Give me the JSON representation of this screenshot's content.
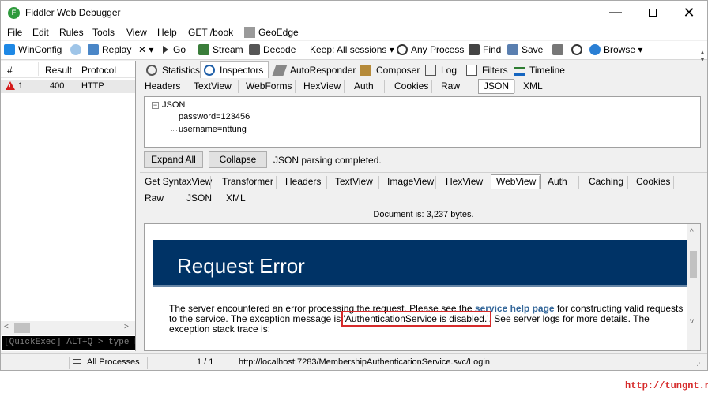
{
  "window": {
    "title": "Fiddler Web Debugger",
    "min_glyph": "—",
    "close_glyph": "✕"
  },
  "menu": [
    "File",
    "Edit",
    "Rules",
    "Tools",
    "View",
    "Help",
    "GET /book",
    "GeoEdge"
  ],
  "toolbar": {
    "winconfig": "WinConfig",
    "replay": "Replay",
    "remove": "✕ ▾",
    "go": "Go",
    "stream": "Stream",
    "decode": "Decode",
    "keep": "Keep: All sessions ▾",
    "any_process": "Any Process",
    "find": "Find",
    "save": "Save",
    "browse": "Browse ▾"
  },
  "sessions": {
    "columns": [
      "#",
      "Result",
      "Protocol"
    ],
    "rows": [
      {
        "id": "1",
        "result": "400",
        "protocol": "HTTP"
      }
    ],
    "quickexec": "[QuickExec] ALT+Q > type HELP t"
  },
  "inspector_tabs": [
    "Statistics",
    "Inspectors",
    "AutoResponder",
    "Composer",
    "Log",
    "Filters",
    "Timeline"
  ],
  "request_tabs": [
    "Headers",
    "TextView",
    "WebForms",
    "HexView",
    "Auth",
    "Cookies",
    "Raw",
    "JSON",
    "XML"
  ],
  "json_view": {
    "toggle": "−",
    "root": "JSON",
    "items": [
      "password=123456",
      "username=nttung"
    ],
    "expand_all": "Expand All",
    "collapse": "Collapse",
    "status": "JSON parsing completed."
  },
  "response_tabs_row1": [
    "Get SyntaxView",
    "Transformer",
    "Headers",
    "TextView",
    "ImageView",
    "HexView",
    "WebView",
    "Auth",
    "Caching",
    "Cookies"
  ],
  "response_tabs_row2": [
    "Raw",
    "JSON",
    "XML"
  ],
  "document_info": "Document is: 3,237 bytes.",
  "webview": {
    "title": "Request Error",
    "text_before_link": "The server encountered an error processing the request. Please see the ",
    "link": "service help page",
    "text_after_link": " for constructing valid requests to the service. The exception message is ",
    "highlight": "'AuthenticationService is disabled.'",
    "text_end": ". See server logs for more details. The exception stack trace is:"
  },
  "statusbar": {
    "processes": "All Processes",
    "count": "1 / 1",
    "url": "http://localhost:7283/MembershipAuthenticationService.svc/Login"
  },
  "watermark": "http://tungnt.net",
  "colors": {
    "banner": "#003366",
    "link": "#336699",
    "highlight_border": "#d62b2b",
    "error_icon": "#d41c1c"
  }
}
